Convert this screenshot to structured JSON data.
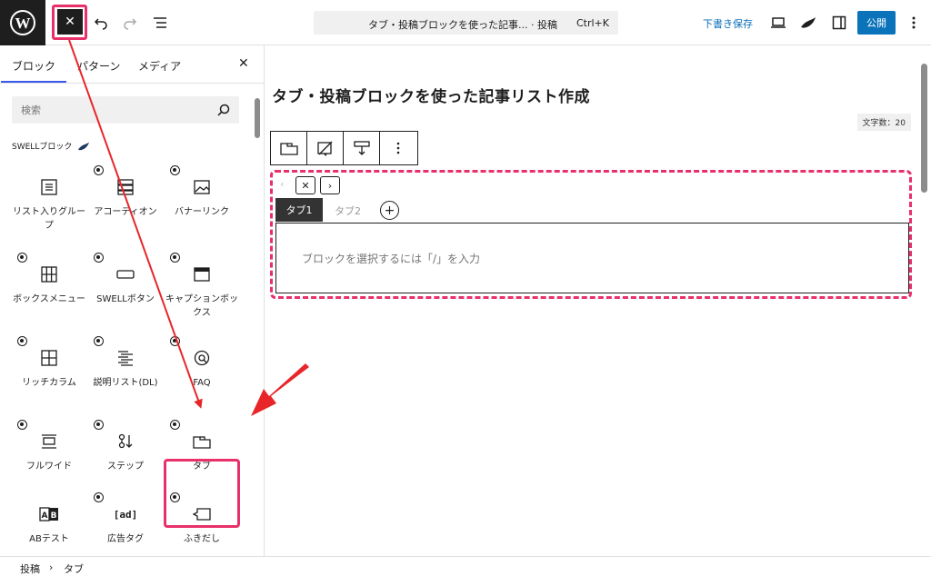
{
  "topbar": {
    "close_label": "✕",
    "command_title": "タブ・投稿ブロックを使った記事... · 投稿",
    "command_shortcut": "Ctrl+K",
    "save_draft": "下書き保存",
    "publish": "公開"
  },
  "sidebar": {
    "tabs": [
      "ブロック",
      "パターン",
      "メディア"
    ],
    "search_placeholder": "検索",
    "section_label": "SWELLブロック",
    "blocks": [
      {
        "label": "リスト入りグループ",
        "icon": "list-icon",
        "badge": false
      },
      {
        "label": "アコーディオン",
        "icon": "accordion-icon",
        "badge": true
      },
      {
        "label": "バナーリンク",
        "icon": "image-icon",
        "badge": true
      },
      {
        "label": "ボックスメニュー",
        "icon": "grid-icon",
        "badge": true
      },
      {
        "label": "SWELLボタン",
        "icon": "button-icon",
        "badge": true
      },
      {
        "label": "キャプションボックス",
        "icon": "caption-box-icon",
        "badge": true
      },
      {
        "label": "リッチカラム",
        "icon": "columns-icon",
        "badge": true
      },
      {
        "label": "説明リスト(DL)",
        "icon": "description-list-icon",
        "badge": true
      },
      {
        "label": "FAQ",
        "icon": "faq-icon",
        "badge": true
      },
      {
        "label": "フルワイド",
        "icon": "full-wide-icon",
        "badge": true
      },
      {
        "label": "ステップ",
        "icon": "step-icon",
        "badge": true
      },
      {
        "label": "タブ",
        "icon": "tab-icon",
        "badge": true
      },
      {
        "label": "ABテスト",
        "icon": "ab-test-icon",
        "badge": false
      },
      {
        "label": "広告タグ",
        "icon": "ad-tag-icon",
        "badge": true
      },
      {
        "label": "ふきだし",
        "icon": "balloon-icon",
        "badge": true
      }
    ]
  },
  "editor": {
    "post_title": "タブ・投稿ブロックを使った記事リスト作成",
    "char_count": "文字数：20",
    "tab1": "タブ1",
    "tab2": "タブ2",
    "placeholder": "ブロックを選択するには「/」を入力"
  },
  "footer": {
    "crumb1": "投稿",
    "crumb2": "タブ"
  },
  "colors": {
    "highlight": "#e8306b",
    "accent": "#0a73ba",
    "dark": "#1e1e1e"
  }
}
